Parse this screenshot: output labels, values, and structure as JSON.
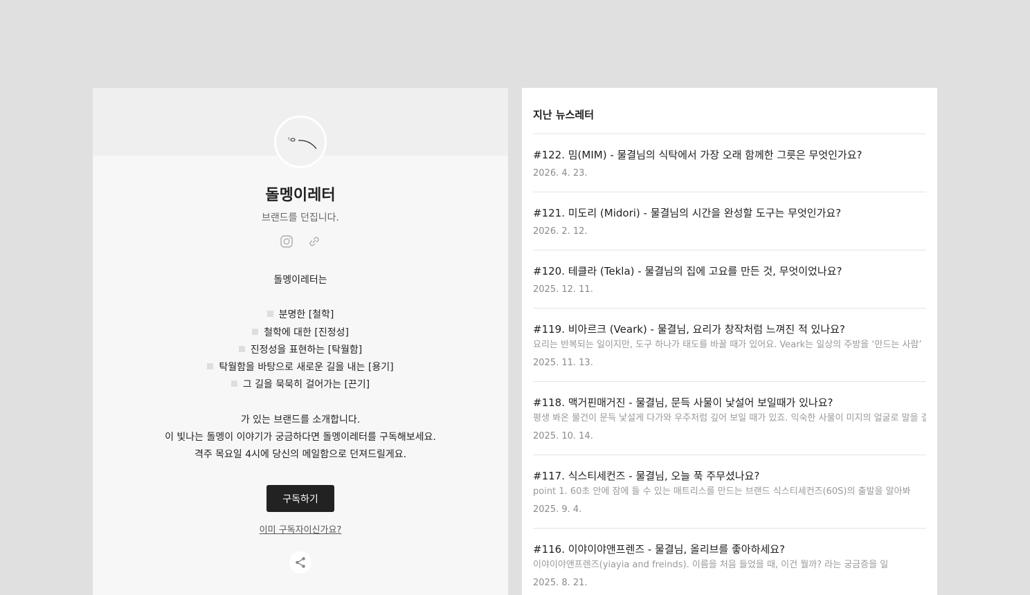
{
  "profile": {
    "name": "돌멩이레터",
    "tagline": "브랜드를 던집니다.",
    "description": {
      "intro": "돌멩이레터는",
      "values": [
        "분명한 [철학]",
        "철학에 대한 [진정성]",
        "진정성을 표현하는 [탁월함]",
        "탁월함을 바탕으로 새로운 길을 내는 [용기]",
        "그 길을 묵묵히 걸어가는 [끈기]"
      ],
      "outro": [
        "가 있는 브랜드를 소개합니다.",
        "이 빛나는 돌멩이 이야기가 궁금하다면 돌멩이레터를 구독해보세요.",
        "격주 목요일 4시에 당신의 메일함으로 던져드릴게요."
      ]
    },
    "subscribe_label": "구독하기",
    "already_label": "이미 구독자이신가요?",
    "icons": [
      "instagram-icon",
      "link-icon",
      "share-icon"
    ]
  },
  "archive": {
    "title": "지난 뉴스레터",
    "items": [
      {
        "title": "#122. 밈(MIM) - 물결님의 식탁에서 가장 오래 함께한 그릇은 무엇인가요?",
        "excerpt": "",
        "date": "2026. 4. 23."
      },
      {
        "title": "#121. 미도리 (Midori) - 물결님의 시간을 완성할 도구는 무엇인가요?",
        "excerpt": "",
        "date": "2026. 2. 12."
      },
      {
        "title": "#120. 테클라 (Tekla) - 물결님의 집에 고요를 만든 것, 무엇이었나요?",
        "excerpt": "",
        "date": "2025. 12. 11."
      },
      {
        "title": "#119. 비아르크 (Veark) - 물결님, 요리가 창작처럼 느껴진 적 있나요?",
        "excerpt": "요리는 반복되는 일이지만, 도구 하나가 태도를 바꿀 때가 있어요. Veark는 일상의 주방을 ‘만드는 사람’",
        "date": "2025. 11. 13."
      },
      {
        "title": "#118. 맥거핀매거진 - 물결님, 문득 사물이 낯설어 보일때가 있나요?",
        "excerpt": "평생 봐온 물건이 문득 낯설게 다가와 우주처럼 깊어 보일 때가 있죠. 익숙한 사물이 미지의 얼굴로 말을 걸",
        "date": "2025. 10. 14."
      },
      {
        "title": "#117. 식스티세컨즈 - 물결님, 오늘 푹 주무셨나요?",
        "excerpt": "point 1. 60초 안에 잠에 들 수 있는 매트리스를 만드는 브랜드 식스티세컨즈(60S)의 출발을 알아봐",
        "date": "2025. 9. 4."
      },
      {
        "title": "#116. 이야이야앤프렌즈 - 물결님, 올리브를 좋아하세요?",
        "excerpt": "이야이야앤프렌즈(yiayia and freinds). 이름을 처음 들었을 때, 이건 뭘까? 라는 궁금증을 일",
        "date": "2025. 8. 21."
      }
    ]
  },
  "colors": {
    "page_bg": "#e0e0e0",
    "left_panel_bg": "#f7f7f7",
    "right_panel_bg": "#ffffff",
    "button_bg": "#222222",
    "muted_text": "#999999"
  }
}
